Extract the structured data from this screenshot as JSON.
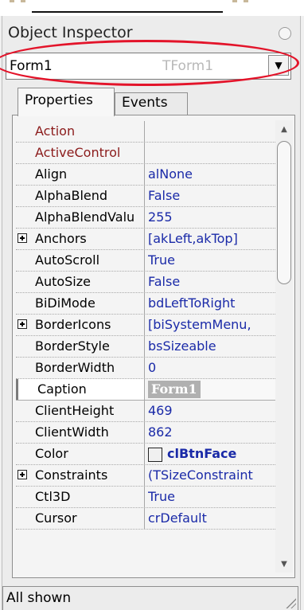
{
  "window": {
    "title": "Object Inspector"
  },
  "component_selector": {
    "name": "Form1",
    "type": "TForm1"
  },
  "tabs": [
    {
      "label": "Properties",
      "active": true
    },
    {
      "label": "Events",
      "active": false
    }
  ],
  "properties": [
    {
      "name": "Action",
      "value": "",
      "kind": "event"
    },
    {
      "name": "ActiveControl",
      "value": "",
      "kind": "event"
    },
    {
      "name": "Align",
      "value": "alNone"
    },
    {
      "name": "AlphaBlend",
      "value": "False"
    },
    {
      "name": "AlphaBlendValu",
      "value": "255"
    },
    {
      "name": "Anchors",
      "value": "[akLeft,akTop]",
      "expandable": true
    },
    {
      "name": "AutoScroll",
      "value": "True"
    },
    {
      "name": "AutoSize",
      "value": "False"
    },
    {
      "name": "BiDiMode",
      "value": "bdLeftToRight"
    },
    {
      "name": "BorderIcons",
      "value": "[biSystemMenu,",
      "expandable": true
    },
    {
      "name": "BorderStyle",
      "value": "bsSizeable"
    },
    {
      "name": "BorderWidth",
      "value": "0"
    },
    {
      "name": "Caption",
      "value": "Form1",
      "selected": true
    },
    {
      "name": "ClientHeight",
      "value": "469"
    },
    {
      "name": "ClientWidth",
      "value": "862"
    },
    {
      "name": "Color",
      "value": "clBtnFace",
      "swatch": true
    },
    {
      "name": "Constraints",
      "value": "(TSizeConstraint",
      "expandable": true
    },
    {
      "name": "Ctl3D",
      "value": "True"
    },
    {
      "name": "Cursor",
      "value": "crDefault"
    }
  ],
  "status": {
    "text": "All shown"
  },
  "colors": {
    "value_text": "#1a2aa8",
    "event_text": "#8b1b1b",
    "highlight_ellipse": "#e3142a"
  }
}
